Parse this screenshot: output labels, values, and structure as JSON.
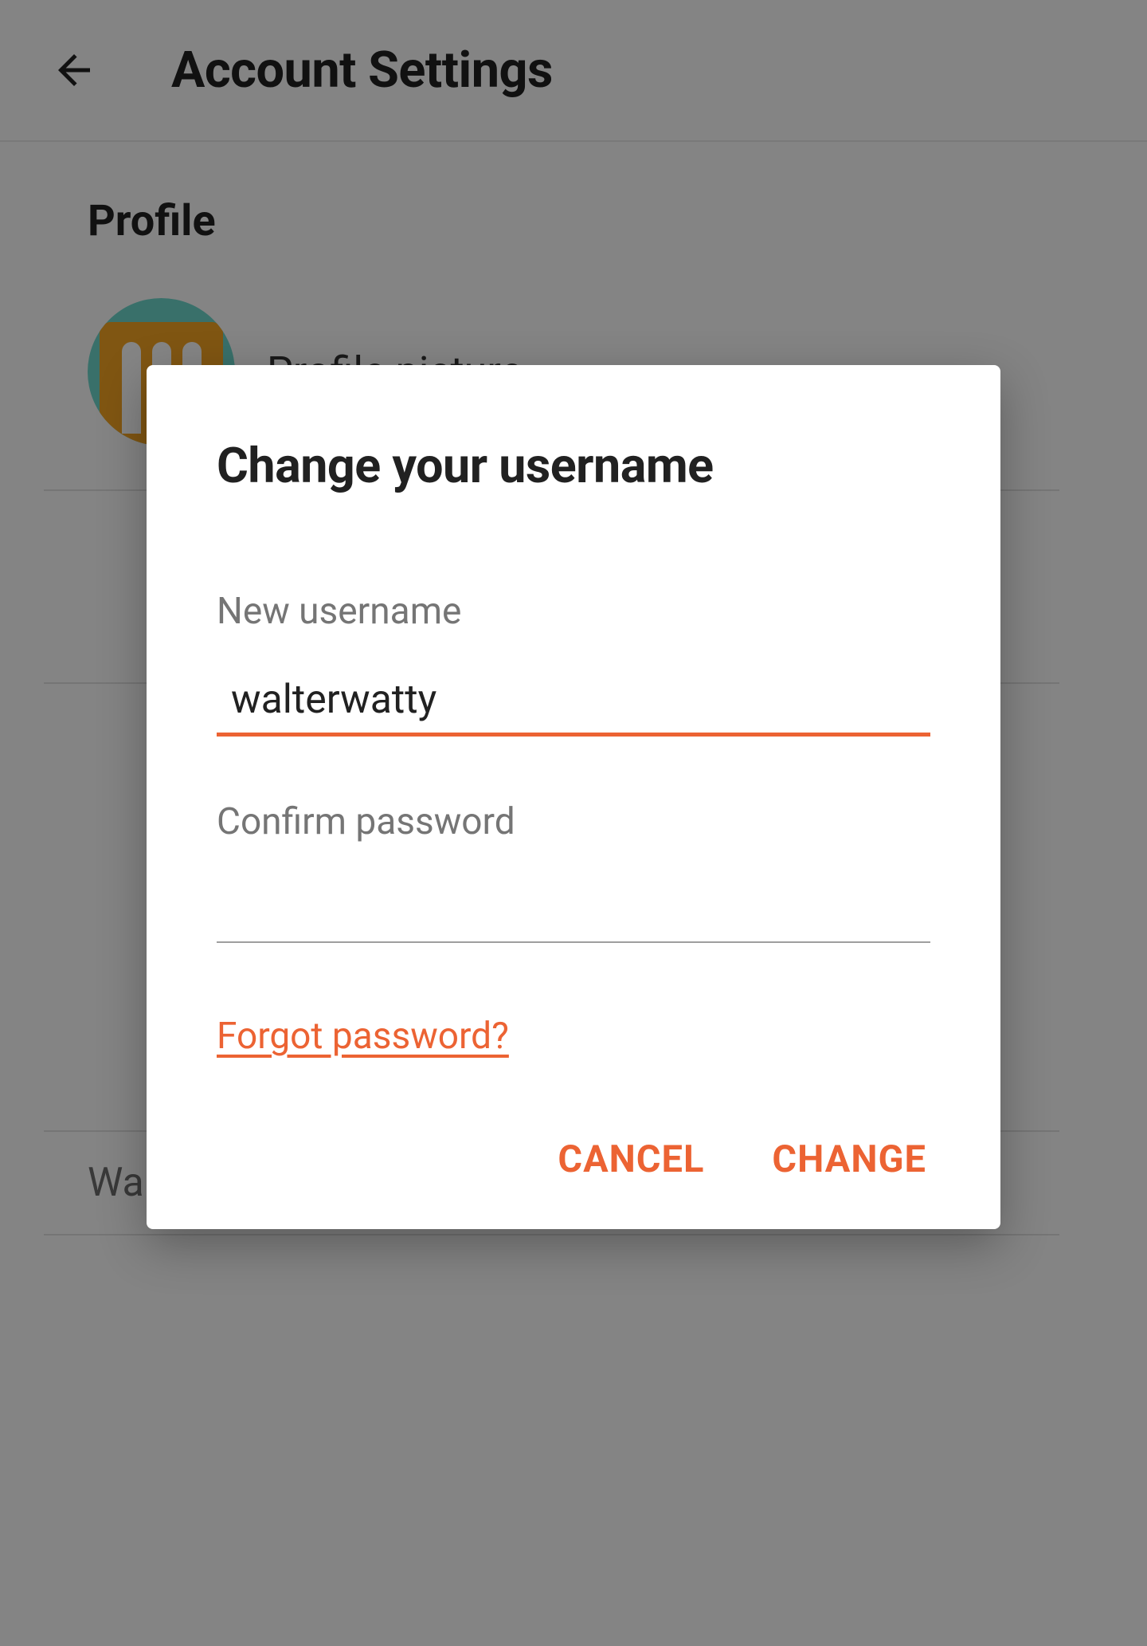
{
  "header": {
    "title": "Account Settings"
  },
  "profile": {
    "section_title": "Profile",
    "picture_label": "Profile picture",
    "display_name": "Walter Watty"
  },
  "dialog": {
    "title": "Change your username",
    "new_username_label": "New username",
    "new_username_value": "walterwatty",
    "confirm_password_label": "Confirm password",
    "confirm_password_value": "",
    "forgot_link": "Forgot password?",
    "cancel_label": "CANCEL",
    "change_label": "CHANGE"
  },
  "colors": {
    "accent": "#ec6333"
  }
}
